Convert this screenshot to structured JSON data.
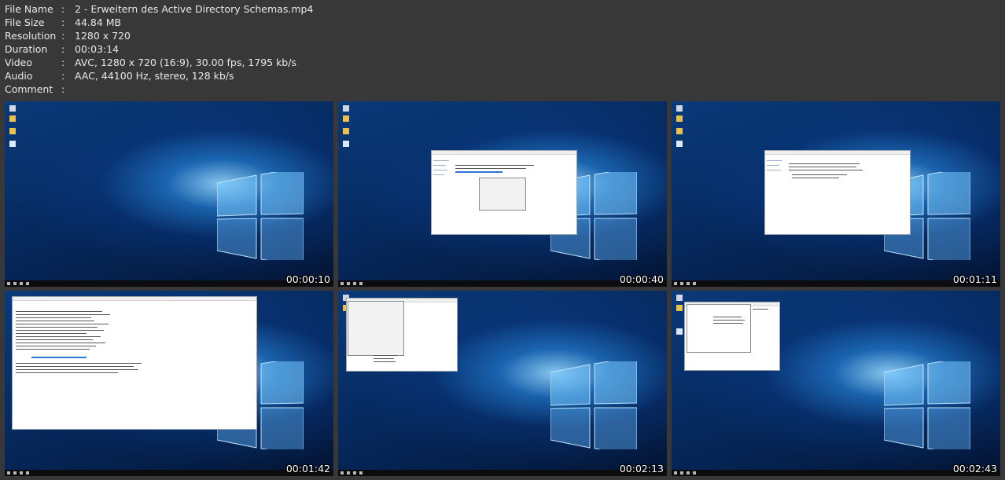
{
  "info": {
    "separator": ":",
    "rows": [
      {
        "label": "File Name",
        "value": "2 - Erweitern des Active Directory Schemas.mp4"
      },
      {
        "label": "File Size",
        "value": "44.84 MB"
      },
      {
        "label": "Resolution",
        "value": "1280 x 720"
      },
      {
        "label": "Duration",
        "value": "00:03:14"
      },
      {
        "label": "Video",
        "value": "AVC, 1280 x 720 (16:9), 30.00 fps, 1795 kb/s"
      },
      {
        "label": "Audio",
        "value": "AAC, 44100 Hz, stereo, 128 kb/s"
      },
      {
        "label": "Comment",
        "value": ""
      }
    ]
  },
  "thumbnails": [
    {
      "timestamp": "00:00:10",
      "scene": "desktop"
    },
    {
      "timestamp": "00:00:40",
      "scene": "explorer-dialog"
    },
    {
      "timestamp": "00:01:11",
      "scene": "explorer"
    },
    {
      "timestamp": "00:01:42",
      "scene": "notepad"
    },
    {
      "timestamp": "00:02:13",
      "scene": "small-dialog"
    },
    {
      "timestamp": "00:02:43",
      "scene": "wizard"
    }
  ],
  "colors": {
    "background": "#383838",
    "desktop_blue": "#0a3a7a",
    "highlight": "#2b74d8"
  }
}
